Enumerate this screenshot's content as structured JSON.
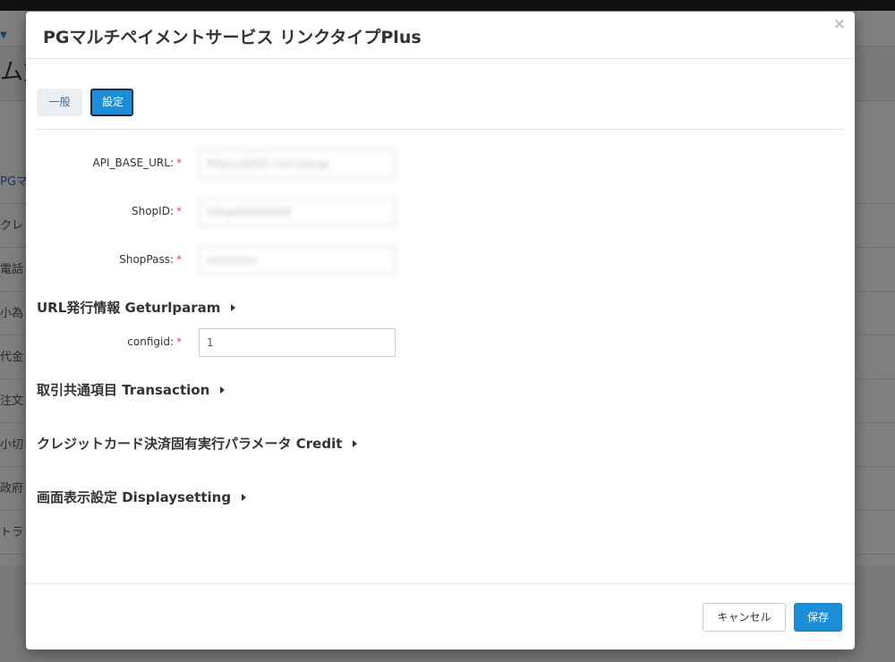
{
  "background": {
    "title_fragment": "ム方",
    "nav_mark": "▼",
    "rows": [
      "PGマ",
      "クレ",
      "電話",
      "小為",
      "代金",
      "注文",
      "小切",
      "政府",
      "トラ"
    ]
  },
  "modal": {
    "title": "PGマルチペイメントサービス リンクタイプPlus",
    "close_label": "×",
    "tabs": {
      "general": "一般",
      "settings": "設定"
    },
    "fields": [
      {
        "label": "API_BASE_URL:",
        "required": "*",
        "value": "https://pt01.mul-pay.jp"
      },
      {
        "label": "ShopID:",
        "required": "*",
        "value": "tshop00000000"
      },
      {
        "label": "ShopPass:",
        "required": "*",
        "value": "xxxxxxxx"
      }
    ],
    "sections": {
      "geturlparam": "URL発行情報 Geturlparam",
      "transaction": "取引共通項目 Transaction",
      "credit": "クレジットカード決済固有実行パラメータ Credit",
      "displaysetting": "画面表示設定 Displaysetting"
    },
    "configid": {
      "label": "configid:",
      "required": "*",
      "value": "1"
    },
    "footer": {
      "cancel": "キャンセル",
      "save": "保存"
    }
  }
}
